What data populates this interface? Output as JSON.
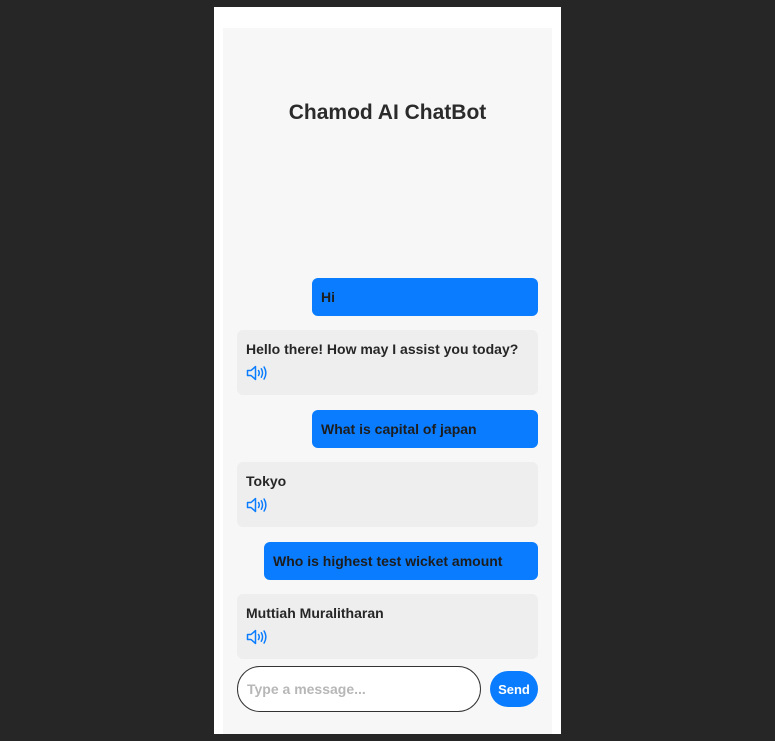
{
  "app": {
    "title": "Chamod AI ChatBot"
  },
  "messages": [
    {
      "role": "user",
      "text": "Hi"
    },
    {
      "role": "bot",
      "text": "Hello there! How may I assist you today?",
      "icon": "speaker-icon"
    },
    {
      "role": "user",
      "text": "What is capital of japan"
    },
    {
      "role": "bot",
      "text": "Tokyo",
      "icon": "speaker-icon"
    },
    {
      "role": "user",
      "text": "Who is highest test wicket amount"
    },
    {
      "role": "bot",
      "text": "Muttiah Muralitharan",
      "icon": "speaker-icon"
    }
  ],
  "composer": {
    "value": "",
    "placeholder": "Type a message...",
    "send_label": "Send"
  },
  "colors": {
    "accent": "#0a7cff",
    "background": "#262626",
    "card": "#f7f7f7",
    "bot_bubble": "#eeeeee"
  }
}
